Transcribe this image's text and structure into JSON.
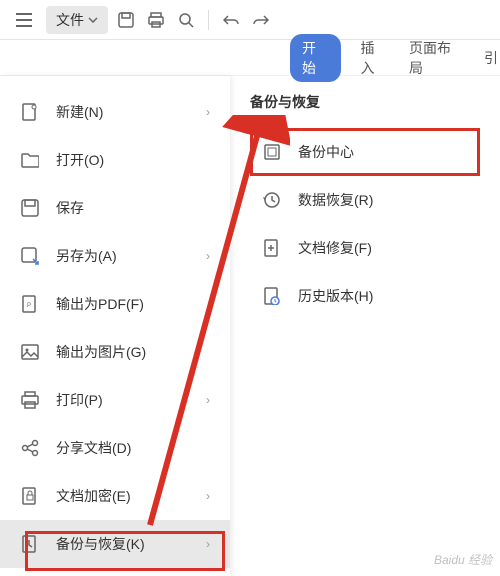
{
  "toolbar": {
    "file_label": "文件"
  },
  "tabs": {
    "start": "开始",
    "insert": "插入",
    "layout": "页面布局",
    "more": "引"
  },
  "fileMenu": {
    "items": [
      {
        "label": "新建(N)",
        "has_arrow": true
      },
      {
        "label": "打开(O)",
        "has_arrow": false
      },
      {
        "label": "保存",
        "has_arrow": false
      },
      {
        "label": "另存为(A)",
        "has_arrow": true
      },
      {
        "label": "输出为PDF(F)",
        "has_arrow": false
      },
      {
        "label": "输出为图片(G)",
        "has_arrow": false
      },
      {
        "label": "打印(P)",
        "has_arrow": true
      },
      {
        "label": "分享文档(D)",
        "has_arrow": false
      },
      {
        "label": "文档加密(E)",
        "has_arrow": true
      },
      {
        "label": "备份与恢复(K)",
        "has_arrow": true
      }
    ]
  },
  "submenu": {
    "title": "备份与恢复",
    "items": [
      {
        "label": "备份中心"
      },
      {
        "label": "数据恢复(R)"
      },
      {
        "label": "文档修复(F)"
      },
      {
        "label": "历史版本(H)"
      }
    ]
  },
  "watermark": "Baidu 经验"
}
